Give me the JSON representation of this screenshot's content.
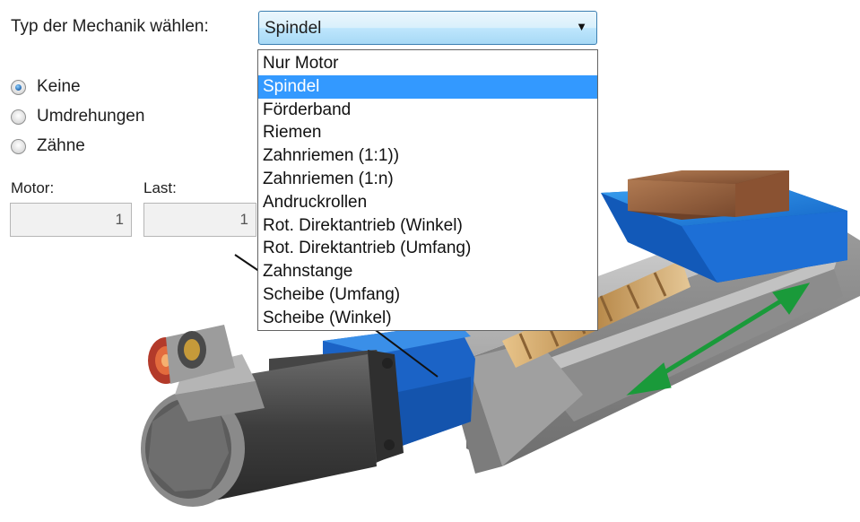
{
  "mechanics": {
    "label": "Typ der Mechanik wählen:",
    "selected": "Spindel",
    "options": [
      "Nur Motor",
      "Spindel",
      "Förderband",
      "Riemen",
      "Zahnriemen (1:1))",
      "Zahnriemen (1:n)",
      "Andruckrollen",
      "Rot. Direktantrieb (Winkel)",
      "Rot. Direktantrieb (Umfang)",
      "Zahnstange",
      "Scheibe (Umfang)",
      "Scheibe (Winkel)"
    ],
    "highlighted_index": 1
  },
  "ratio_mode": {
    "options": [
      "Keine",
      "Umdrehungen",
      "Zähne"
    ],
    "checked": "Keine"
  },
  "gear_ratio": {
    "motor_label": "Motor:",
    "motor_value": "1",
    "load_label": "Last:",
    "load_value": "1"
  },
  "icons": {
    "dropdown_arrow": "chevron-down-icon",
    "illustration": "spindle-drive-illustration"
  },
  "colors": {
    "selection": "#3399ff",
    "drive_blue": "#1a6fd1",
    "arrow_green": "#1a9a3a",
    "carriage_brown": "#8a5a3c"
  }
}
